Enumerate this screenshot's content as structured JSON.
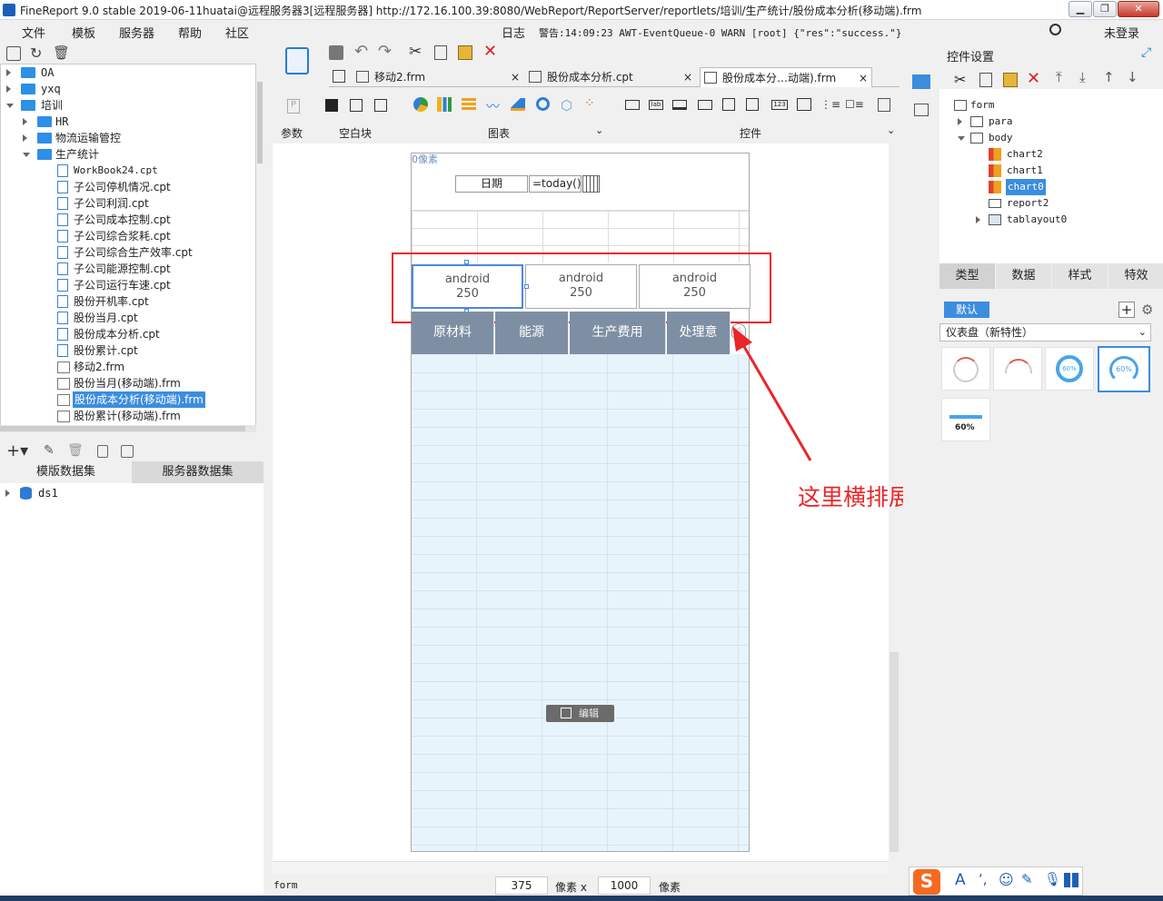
{
  "titlebar": {
    "title": "FineReport 9.0 stable 2019-06-11huatai@远程服务器3[远程服务器]    http://172.16.100.39:8080/WebReport/ReportServer/reportlets/培训/生产统计/股份成本分析(移动端).frm"
  },
  "menubar": {
    "items": [
      "文件",
      "模板",
      "服务器",
      "帮助",
      "社区"
    ],
    "log_label": "日志",
    "warning": "警告:14:09:23 AWT-EventQueue-0 WARN [root] {\"res\":\"success.\"}",
    "login": "未登录"
  },
  "tree": {
    "items": [
      {
        "label": "OA"
      },
      {
        "label": "yxq"
      },
      {
        "label": "培训"
      },
      {
        "label": "HR"
      },
      {
        "label": "物流运输管控"
      },
      {
        "label": "生产统计"
      },
      {
        "label": "WorkBook24.cpt"
      },
      {
        "label": "子公司停机情况.cpt"
      },
      {
        "label": "子公司利润.cpt"
      },
      {
        "label": "子公司成本控制.cpt"
      },
      {
        "label": "子公司综合浆耗.cpt"
      },
      {
        "label": "子公司综合生产效率.cpt"
      },
      {
        "label": "子公司能源控制.cpt"
      },
      {
        "label": "子公司运行车速.cpt"
      },
      {
        "label": "股份开机率.cpt"
      },
      {
        "label": "股份当月.cpt"
      },
      {
        "label": "股份成本分析.cpt"
      },
      {
        "label": "股份累计.cpt"
      },
      {
        "label": "移动2.frm"
      },
      {
        "label": "股份当月(移动端).frm"
      },
      {
        "label": "股份成本分析(移动端).frm"
      },
      {
        "label": "股份累计(移动端).frm"
      }
    ]
  },
  "datasets": {
    "tab_template": "模版数据集",
    "tab_server": "服务器数据集",
    "items": [
      "ds1"
    ]
  },
  "tabs": [
    "移动2.frm",
    "股份成本分析.cpt",
    "股份成本分…动端).frm"
  ],
  "toolbar": {
    "param_label": "参数",
    "blank_label": "空白块",
    "chart_label": "图表",
    "widget_label": "控件"
  },
  "canvas": {
    "px_label": "0像素",
    "date_label": "日期",
    "date_formula": "=today()",
    "charts": [
      {
        "name": "android",
        "value": "250"
      },
      {
        "name": "android",
        "value": "250"
      },
      {
        "name": "android",
        "value": "250"
      }
    ],
    "headers": [
      "原材料",
      "能源",
      "生产费用",
      "处理意"
    ],
    "edit_button": "编辑"
  },
  "annotation": {
    "text": "这里横排展示",
    "color": "#e8262a"
  },
  "statusbar": {
    "form_label": "form",
    "width_value": "375",
    "unit1": "像素 x",
    "height_value": "1000",
    "unit2": "像素"
  },
  "right": {
    "title": "控件设置",
    "tree": [
      "form",
      "para",
      "body",
      "chart2",
      "chart1",
      "chart0",
      "report2",
      "tablayout0"
    ],
    "tabs": [
      "类型",
      "数据",
      "样式",
      "特效"
    ],
    "default_btn": "默认",
    "select_value": "仪表盘（新特性）",
    "gauge_labels": [
      "60%",
      "60%",
      "60%"
    ]
  }
}
